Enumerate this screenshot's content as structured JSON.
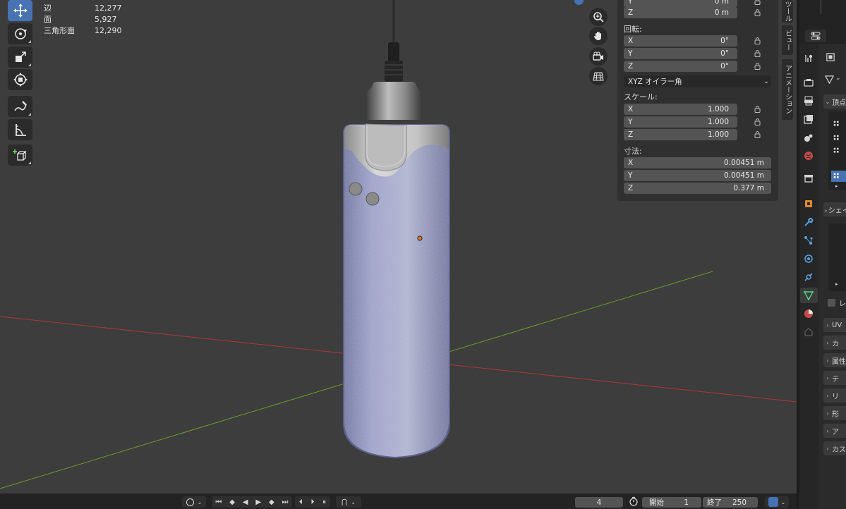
{
  "stats": [
    {
      "label": "辺",
      "value": "12,277"
    },
    {
      "label": "面",
      "value": "5,927"
    },
    {
      "label": "三角形面",
      "value": "12,290"
    }
  ],
  "toolbar": {
    "tools": [
      {
        "name": "move-tool",
        "icon": "move-icon",
        "active": true
      },
      {
        "name": "rotate-tool",
        "icon": "rotate-icon",
        "active": false
      },
      {
        "name": "scale-tool",
        "icon": "scale-icon",
        "active": false
      },
      {
        "name": "transform-tool",
        "icon": "transform-icon",
        "active": false
      },
      {
        "name": "annotate-tool",
        "icon": "annotate-icon",
        "active": false
      },
      {
        "name": "measure-tool",
        "icon": "measure-icon",
        "active": false
      },
      {
        "name": "add-cube-tool",
        "icon": "add-cube-icon",
        "active": false
      }
    ]
  },
  "nav": [
    "zoom-icon",
    "hand-icon",
    "camera-icon",
    "grid-icon"
  ],
  "npanel": {
    "location_y": {
      "axis": "Y",
      "value": "0 m"
    },
    "location_z": {
      "axis": "Z",
      "value": "0 m"
    },
    "rotation_label": "回転:",
    "rotation": [
      {
        "axis": "X",
        "value": "0°"
      },
      {
        "axis": "Y",
        "value": "0°"
      },
      {
        "axis": "Z",
        "value": "0°"
      }
    ],
    "rotation_mode": "XYZ オイラー角",
    "scale_label": "スケール:",
    "scale": [
      {
        "axis": "X",
        "value": "1.000"
      },
      {
        "axis": "Y",
        "value": "1.000"
      },
      {
        "axis": "Z",
        "value": "1.000"
      }
    ],
    "dimensions_label": "寸法:",
    "dimensions": [
      {
        "axis": "X",
        "value": "0.00451 m"
      },
      {
        "axis": "Y",
        "value": "0.00451 m"
      },
      {
        "axis": "Z",
        "value": "0.377 m"
      }
    ]
  },
  "vtabs": {
    "tool": "ツール",
    "view": "ビュー",
    "animation": "アニメーション"
  },
  "properties": {
    "groups": [
      {
        "label": "頂点"
      },
      {
        "label": "シェイプキー"
      },
      {
        "label": "レ"
      },
      {
        "label": "UV"
      },
      {
        "label": "カ"
      },
      {
        "label": "属性"
      },
      {
        "label": "テ"
      },
      {
        "label": "リ"
      },
      {
        "label": "形"
      },
      {
        "label": "ア"
      },
      {
        "label": "カス"
      }
    ]
  },
  "timeline": {
    "current_frame": "4",
    "start_label": "開始",
    "start_value": "1",
    "end_label": "終了",
    "end_value": "250"
  },
  "colors": {
    "active_tool": "#4772b3",
    "x_axis": "#b0363e",
    "y_axis": "#6a9a2a",
    "object_texture": "#8a8fc0"
  }
}
